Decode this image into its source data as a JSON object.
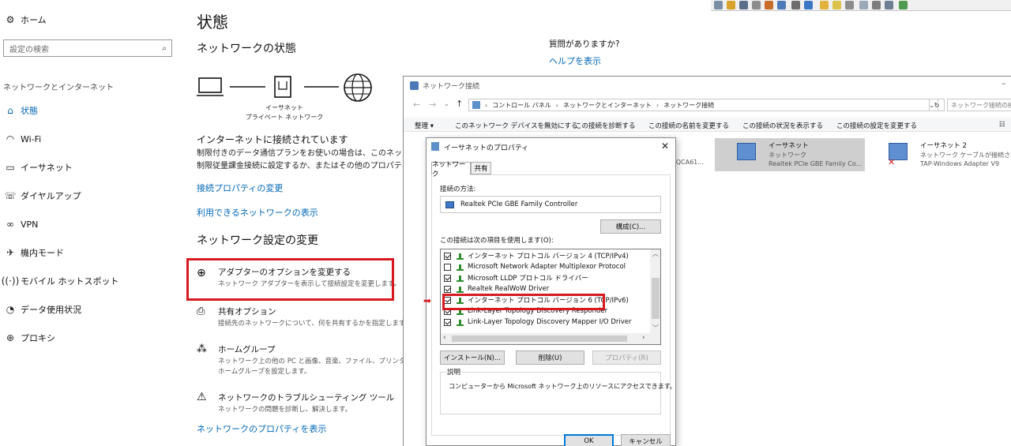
{
  "settings": {
    "sidebar": {
      "home": "ホーム",
      "search_placeholder": "設定の検索",
      "section_heading": "ネットワークとインターネット",
      "items": [
        {
          "label": "状態",
          "icon": "home-icon"
        },
        {
          "label": "Wi-Fi",
          "icon": "wifi-icon"
        },
        {
          "label": "イーサネット",
          "icon": "ethernet-icon"
        },
        {
          "label": "ダイヤルアップ",
          "icon": "dialup-icon"
        },
        {
          "label": "VPN",
          "icon": "vpn-icon"
        },
        {
          "label": "機内モード",
          "icon": "airplane-icon"
        },
        {
          "label": "モバイル ホットスポット",
          "icon": "hotspot-icon"
        },
        {
          "label": "データ使用状況",
          "icon": "data-usage-icon"
        },
        {
          "label": "プロキシ",
          "icon": "globe-icon"
        }
      ]
    },
    "main": {
      "title": "状態",
      "network_status_heading": "ネットワークの状態",
      "diagram_label_line1": "イーサネット",
      "diagram_label_line2": "プライベート ネットワーク",
      "connected_heading": "インターネットに接続されています",
      "desc_line1": "制限付きのデータ通信プランをお使いの場合は、このネットワーク",
      "desc_line2": "制限従量課金接続に設定するか、またはその他のプロパティを変更し",
      "link_connection_props": "接続プロパティの変更",
      "link_available_networks": "利用できるネットワークの表示",
      "change_settings_heading": "ネットワーク設定の変更",
      "options": [
        {
          "title": "アダプターのオプションを変更する",
          "desc": "ネットワーク アダプターを表示して接続設定を変更します。"
        },
        {
          "title": "共有オプション",
          "desc": "接続先のネットワークについて、何を共有するかを指定します。"
        },
        {
          "title": "ホームグループ",
          "desc": "ネットワーク上の他の PC と画像、音楽、ファイル、プリンターを共",
          "desc2": "ホームグループを設定します。"
        },
        {
          "title": "ネットワークのトラブルシューティング ツール",
          "desc": "ネットワークの問題を診断し、解決します。"
        }
      ],
      "link_network_props": "ネットワークのプロパティを表示",
      "help_question": "質問がありますか?",
      "help_link": "ヘルプを表示"
    }
  },
  "netwin": {
    "title": "ネットワーク接続",
    "breadcrumb": [
      "コントロール パネル",
      "ネットワークとインターネット",
      "ネットワーク接続"
    ],
    "search_placeholder": "ネットワーク接続の検索",
    "commands": [
      "整理 ▾",
      "このネットワーク デバイスを無効にする",
      "この接続を診断する",
      "この接続の名前を変更する",
      "この接続の状況を表示する",
      "この接続の設定を変更する"
    ],
    "partial_left": "s QCA61...",
    "connections": [
      {
        "name": "イーサネット",
        "line2": "ネットワーク",
        "line3": "Realtek PCIe GBE Family Co..."
      },
      {
        "name": "イーサネット 2",
        "line2": "ネットワーク ケーブルが接続され...",
        "line3": "TAP-Windows Adapter V9"
      }
    ]
  },
  "dialog": {
    "title": "イーサネットのプロパティ",
    "tabs": [
      "ネットワーク",
      "共有"
    ],
    "connect_using_label": "接続の方法:",
    "adapter_name": "Realtek PCIe GBE Family Controller",
    "configure_button": "構成(C)...",
    "items_label": "この接続は次の項目を使用します(O):",
    "items": [
      {
        "label": "インターネット プロトコル バージョン 4 (TCP/IPv4)",
        "checked": true
      },
      {
        "label": "Microsoft Network Adapter Multiplexor Protocol",
        "checked": false
      },
      {
        "label": "Microsoft LLDP プロトコル ドライバー",
        "checked": true
      },
      {
        "label": "Realtek RealWoW Driver",
        "checked": true
      },
      {
        "label": "インターネット プロトコル バージョン 6 (TCP/IPv6)",
        "checked": true
      },
      {
        "label": "Link-Layer Topology Discovery Responder",
        "checked": true
      },
      {
        "label": "Link-Layer Topology Discovery Mapper I/O Driver",
        "checked": true
      }
    ],
    "install_button": "インストール(N)...",
    "uninstall_button": "削除(U)",
    "properties_button": "プロパティ(R)",
    "description_label": "説明",
    "description_text": "コンピューターから Microsoft ネットワーク上のリソースにアクセスできます。",
    "ok_button": "OK",
    "cancel_button": "キャンセル"
  },
  "colors": {
    "accent": "#0063b1",
    "link": "#0067b8",
    "highlight_red": "#d71920"
  }
}
